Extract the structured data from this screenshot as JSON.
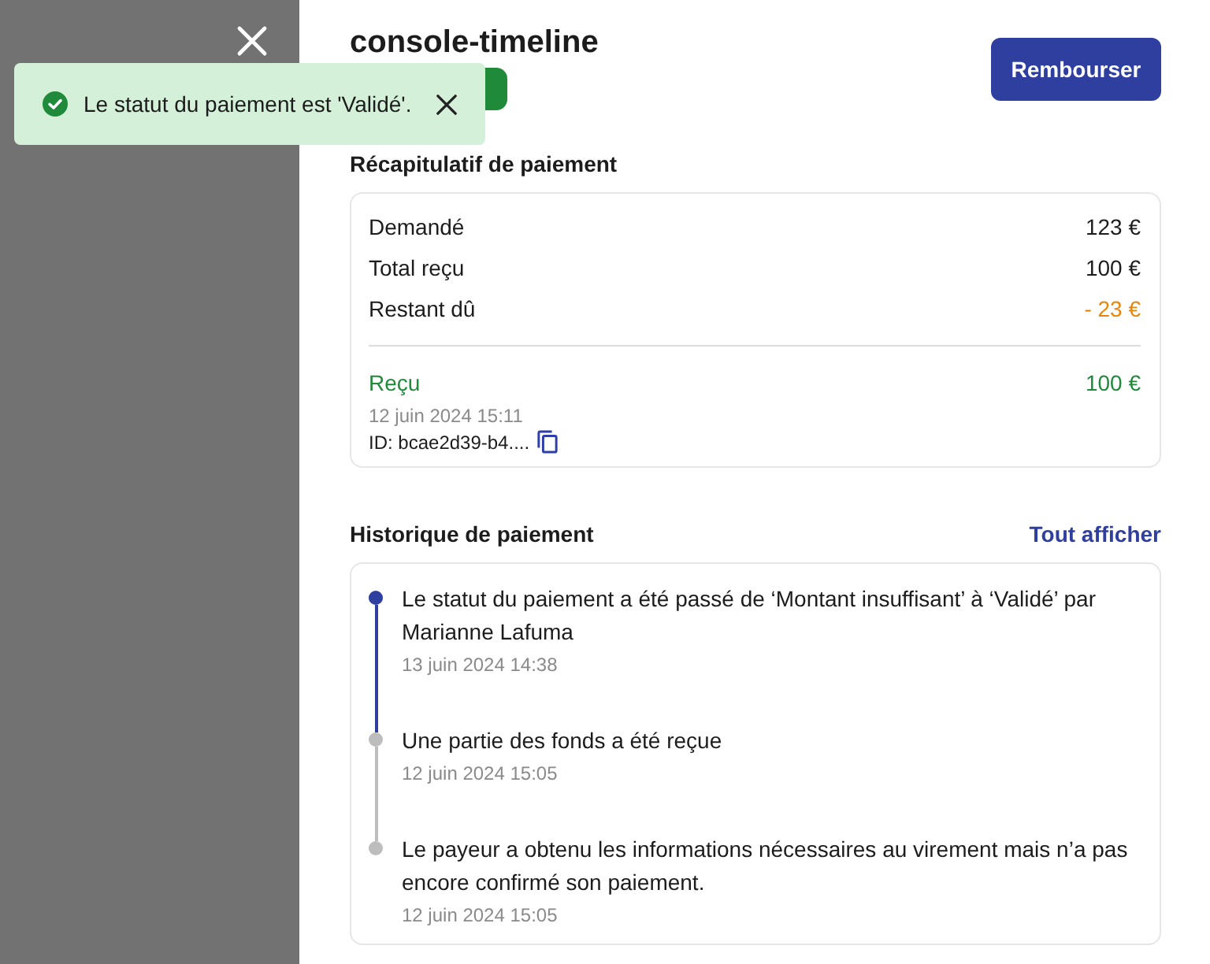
{
  "toast": {
    "kind": "success",
    "message": "Le statut du paiement est 'Validé'."
  },
  "panel": {
    "title": "console-timeline",
    "action": "Rembourser"
  },
  "summary": {
    "title": "Récapitulatif de paiement",
    "rows": [
      {
        "label": "Demandé",
        "value": "123 €",
        "kind": "normal"
      },
      {
        "label": "Total reçu",
        "value": "100 €",
        "kind": "normal"
      },
      {
        "label": "Restant dû",
        "value": "- 23 €",
        "kind": "warning"
      }
    ],
    "receipt": {
      "label": "Reçu",
      "amount": "100 €",
      "date": "12 juin 2024 15:11",
      "id": "ID: bcae2d39-b4...."
    }
  },
  "history": {
    "title": "Historique de paiement",
    "link": "Tout afficher",
    "items": [
      {
        "text": "Le statut du paiement a été passé de ‘Montant insuffisant’ à ‘Validé’ par Marianne Lafuma",
        "date": "13 juin 2024 14:38",
        "current": true
      },
      {
        "text": "Une partie des fonds a été reçue",
        "date": "12 juin 2024 15:05",
        "current": false
      },
      {
        "text": "Le payeur a obtenu les informations nécessaires au virement mais n’a pas encore confirmé son paiement.",
        "date": "12 juin 2024 15:05",
        "current": false
      }
    ]
  }
}
